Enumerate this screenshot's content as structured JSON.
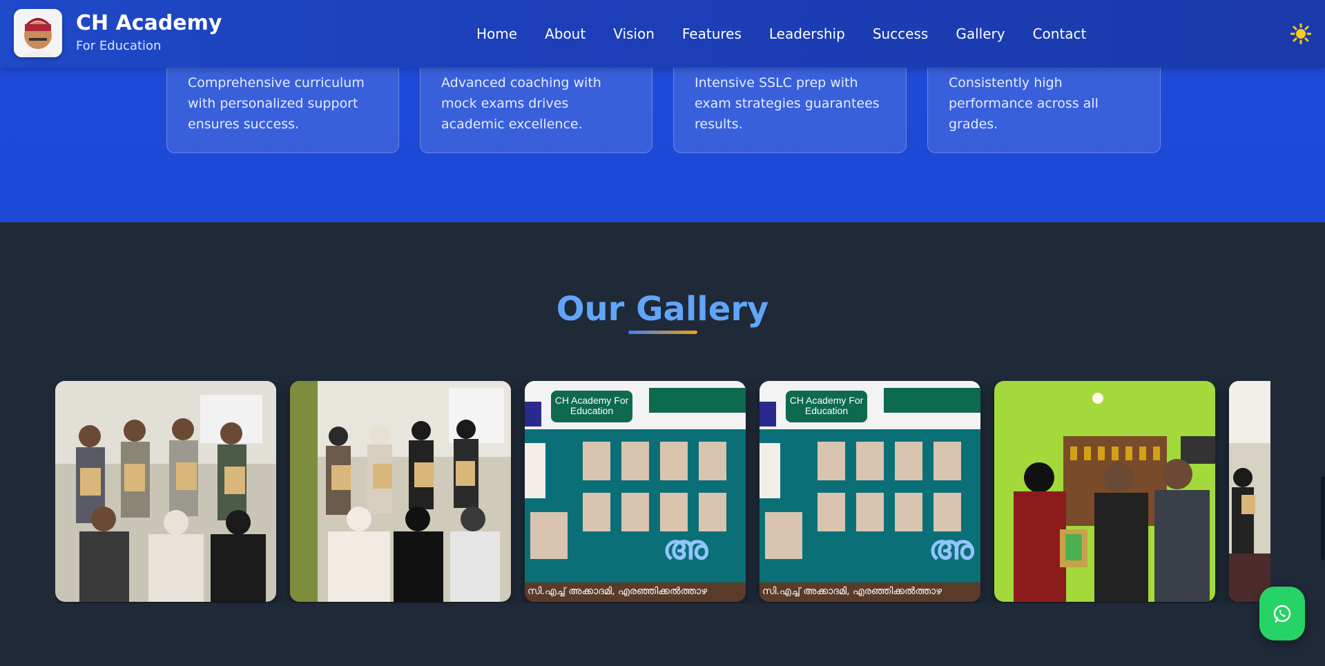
{
  "header": {
    "brand_title": "CH Academy",
    "brand_subtitle": "For Education",
    "nav": [
      "Home",
      "About",
      "Vision",
      "Features",
      "Leadership",
      "Success",
      "Gallery",
      "Contact"
    ],
    "theme_icon": "sun-icon"
  },
  "cards": [
    {
      "text": "Comprehensive curriculum with personalized support ensures success."
    },
    {
      "text": "Advanced coaching with mock exams drives academic excellence."
    },
    {
      "text": "Intensive SSLC prep with exam strategies guarantees results."
    },
    {
      "text": "Consistently high performance across all grades."
    }
  ],
  "gallery": {
    "title": "Our Gallery",
    "poster_head": "CH Academy For Education",
    "poster_foot": "സി.എച്ച് അക്കാദമി, എരഞ്ഞിക്കൽത്താഴ",
    "items": [
      "group-photo-boys",
      "group-photo-girls",
      "poster-1",
      "poster-2",
      "award-photo",
      "partial-photo"
    ]
  },
  "colors": {
    "primary": "#1e49c8",
    "dark_bg": "#1f2937",
    "accent_blue": "#60a5fa",
    "accent_orange": "#f59e0b",
    "whatsapp": "#25d366"
  },
  "whatsapp_icon": "whatsapp-icon"
}
